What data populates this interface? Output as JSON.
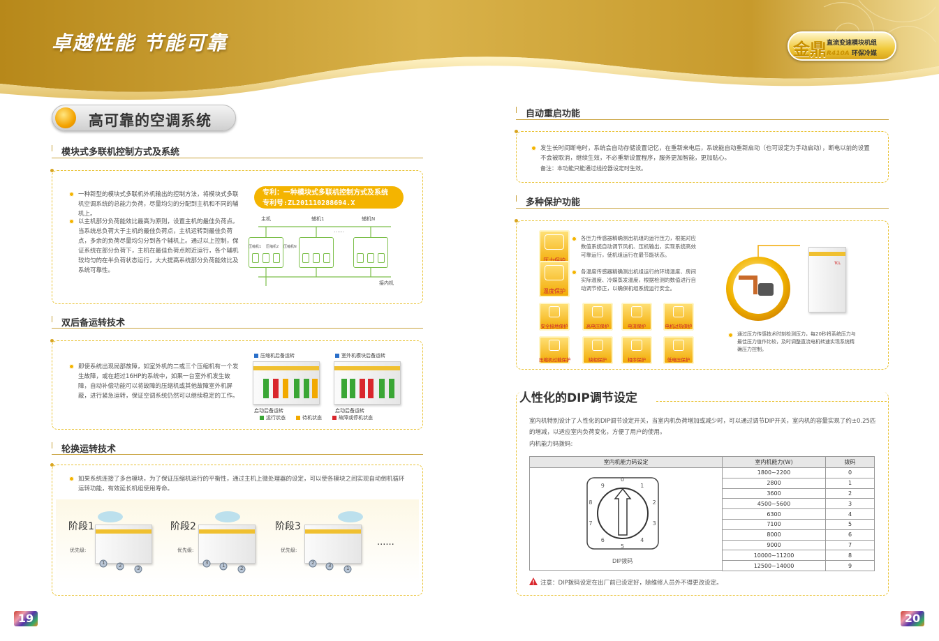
{
  "header": {
    "title": "卓越性能 节能可靠",
    "logo": {
      "big": "金鼎",
      "line1": "直流变速模块机组",
      "brand": "R410A",
      "line2": "环保冷媒"
    }
  },
  "left": {
    "main_title": "高可靠的空调系统",
    "s1": {
      "title": "模块式多联机控制方式及系统",
      "bullets": [
        "一种新型的模块式多联机外机输出的控制方法，将模块式多联机空调系统的总能力负荷，尽量均匀的分配到主机和不同的辅机上。",
        "以主机部分负荷能效比最高为原则，设置主机的最佳负荷点。当系统总负荷大于主机的最佳负荷点，主机运转到最佳负荷点，多余的负荷尽量均匀分到各个辅机上。通过以上控制，保证系统在部分负荷下，主机在最佳负荷点附近运行，各个辅机较均匀的在半负荷状态运行，大大提高系统部分负荷能效比及系统可靠性。"
      ],
      "patent1": "专利：一种模块式多联机控制方式及系统",
      "patent2": "专利号:ZL201110288694.X",
      "diagram": {
        "master": "主机",
        "aux1": "辅机1",
        "auxN": "辅机N",
        "dots": "......",
        "c1": "压缩机1",
        "c2": "压缩机2",
        "cN": "压缩机N",
        "indoor": "接内机"
      }
    },
    "s2": {
      "title": "双后备运转技术",
      "bullet": "即使系统出现局部故障，如室外机的二或三个压缩机有一个发生故障，或在超过16HP的系统中，如果一台室外机发生故障，自动补偿功能可以将故障的压缩机或其他故障室外机屏蔽，进行紧急运转，保证空调系统仍然可以继续稳定的工作。",
      "cap1": "压缩机后备运转",
      "cap2": "室外机模块后备运转",
      "start1": "启动后备运转",
      "start2": "启动后备运转",
      "legend": [
        "运行状态",
        "待机状态",
        "故障或停机状态"
      ],
      "legend_colors": [
        "#3aa635",
        "#f2a900",
        "#d9262c"
      ]
    },
    "s3": {
      "title": "轮换运转技术",
      "bullet": "如果系统连接了多台模块，为了保证压缩机运行的平衡性，通过主机上微处理器的设定，可以使各模块之间实现自动倒机循环运转功能，有效延长机组使用寿命。",
      "stages": [
        {
          "label": "阶段1",
          "prio": "优先级:",
          "nums": [
            "1",
            "2",
            "3"
          ]
        },
        {
          "label": "阶段2",
          "prio": "优先级:",
          "nums": [
            "3",
            "1",
            "2"
          ]
        },
        {
          "label": "阶段3",
          "prio": "优先级:",
          "nums": [
            "2",
            "3",
            "1"
          ]
        }
      ],
      "dots": "......"
    },
    "page": "19"
  },
  "right": {
    "s4": {
      "title": "自动重启功能",
      "bullet": "发生长时间断电时，系统会自动存储设置记忆，在重新来电后，系统能自动重新启动（也可设定为手动启动），断电以前的设置不会被取消，继续生效，不必重新设置程序，服务更加智能，更加贴心。",
      "note": "备注：本功能只能通过线控器设定时生效。"
    },
    "s5": {
      "title": "多种保护功能",
      "pressure": {
        "label": "压力保护",
        "text": "各压力传感器精确测出机组的运行压力，根据对应数值系统自动调节风机、压机输出，实现系统高效可靠运行，使机组运行在最节能状态。"
      },
      "temp": {
        "label": "温度保护",
        "text": "各温度传感器精确测出机组运行的环境温度、房间实际温度、冷媒蒸发温度，根据检测的数值进行自动调节修正，以确保机组系统运行安全。"
      },
      "icons": [
        "安全接地保护",
        "高电压保护",
        "电流保护",
        "电机过热保护",
        "压缩机过载保护",
        "缺相保护",
        "相序保护",
        "低电压保护"
      ],
      "caption": "通过压力传感技术时刻检测压力，每20秒将系统压力与最佳压力值作比较，及时调整直流电机转速实现系统精确压力控制。",
      "unit_brand": "TCL"
    },
    "s6": {
      "title": "人性化的DIP调节设定",
      "text": "室内机特别设计了人性化的DIP调节设定开关，当室内机负荷增加或减少时，可以通过调节DIP开关，室内机的容量实现了约±0.25匹的增减，以适应室内负荷变化，方便了用户的使用。",
      "sub": "内机能力码拨码:",
      "table": {
        "h1": "室内机能力码设定",
        "h2": "室内机能力(W)",
        "h3": "拨码",
        "rows": [
          [
            "1800~2200",
            "0"
          ],
          [
            "2800",
            "1"
          ],
          [
            "3600",
            "2"
          ],
          [
            "4500~5600",
            "3"
          ],
          [
            "6300",
            "4"
          ],
          [
            "7100",
            "5"
          ],
          [
            "8000",
            "6"
          ],
          [
            "9000",
            "7"
          ],
          [
            "10000~11200",
            "8"
          ],
          [
            "12500~14000",
            "9"
          ]
        ],
        "dial": [
          "0",
          "1",
          "2",
          "3",
          "4",
          "5",
          "6",
          "7",
          "8",
          "9"
        ],
        "dial_label": "DIP拨码"
      },
      "warn": "注意：DIP拨码设定在出厂前已设定好，除维修人员外不得更改设定。"
    },
    "page": "20"
  },
  "colors": {
    "gold": "#d9a520",
    "accent": "#f4b400",
    "green": "#7cbf4a"
  }
}
